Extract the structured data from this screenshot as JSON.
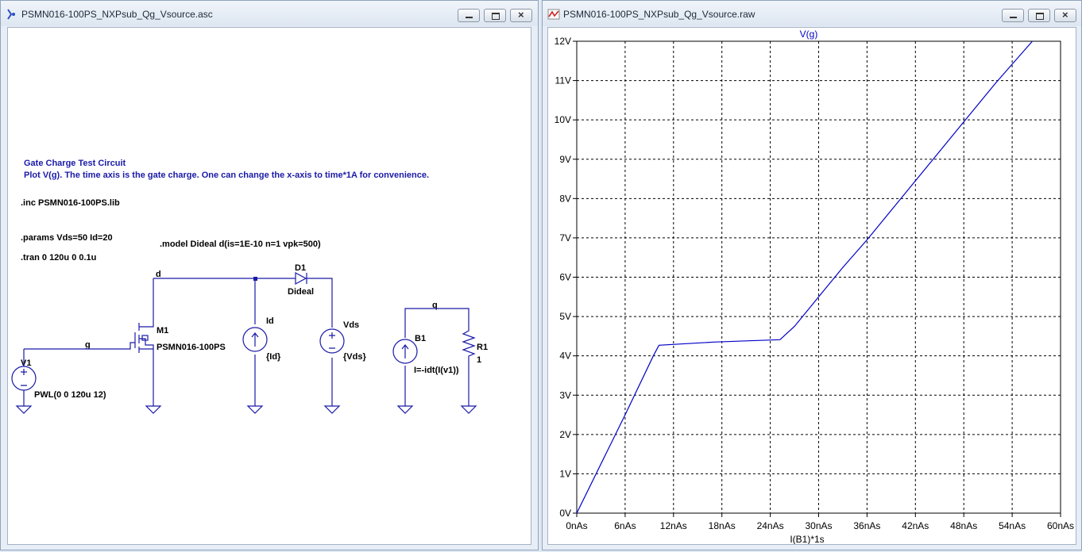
{
  "schematic": {
    "title": "PSMN016-100PS_NXPsub_Qg_Vsource.asc",
    "comment_line1": "Gate Charge Test Circuit",
    "comment_line2": "Plot V(g). The time axis is the gate charge. One can change the x-axis to time*1A for convenience.",
    "inc": ".inc PSMN016-100PS.lib",
    "params": ".params Vds=50 Id=20",
    "tran": ".tran 0 120u 0 0.1u",
    "model": ".model  Dideal  d(is=1E-10 n=1 vpk=500)",
    "net_d": "d",
    "net_g": "g",
    "net_q": "q",
    "m1_name": "M1",
    "m1_part": "PSMN016-100PS",
    "v1_name": "V1",
    "v1_value": "PWL(0 0 120u 12)",
    "id_name": "Id",
    "id_value": "{Id}",
    "vds_name": "Vds",
    "vds_value": "{Vds}",
    "d1_name": "D1",
    "d1_model": "Dideal",
    "b1_name": "B1",
    "b1_expr": "I=-idt(I(v1))",
    "r1_name": "R1",
    "r1_value": "1"
  },
  "plot": {
    "title": "PSMN016-100PS_NXPsub_Qg_Vsource.raw",
    "trace_label": "V(g)",
    "x_axis_label": "I(B1)*1s",
    "trace_color": "#0000c8"
  },
  "chart_data": {
    "type": "line",
    "title": "V(g)",
    "xlabel": "I(B1)*1s",
    "ylabel": "",
    "x_ticks": [
      "0nAs",
      "6nAs",
      "12nAs",
      "18nAs",
      "24nAs",
      "30nAs",
      "36nAs",
      "42nAs",
      "48nAs",
      "54nAs",
      "60nAs"
    ],
    "y_ticks": [
      "0V",
      "1V",
      "2V",
      "3V",
      "4V",
      "5V",
      "6V",
      "7V",
      "8V",
      "9V",
      "10V",
      "11V",
      "12V"
    ],
    "xlim": [
      0,
      60
    ],
    "ylim": [
      0,
      12
    ],
    "grid": true,
    "series": [
      {
        "name": "V(g)",
        "x": [
          0,
          6.0,
          9.5,
          10.2,
          17.0,
          21.0,
          25.2,
          27.0,
          30.0,
          33.0,
          36.0,
          40.0,
          44.0,
          48.0,
          52.0,
          56.5
        ],
        "y": [
          0,
          2.5,
          4.0,
          4.27,
          4.35,
          4.38,
          4.41,
          4.75,
          5.5,
          6.25,
          6.95,
          7.95,
          8.95,
          9.95,
          10.95,
          12.0
        ]
      }
    ]
  }
}
